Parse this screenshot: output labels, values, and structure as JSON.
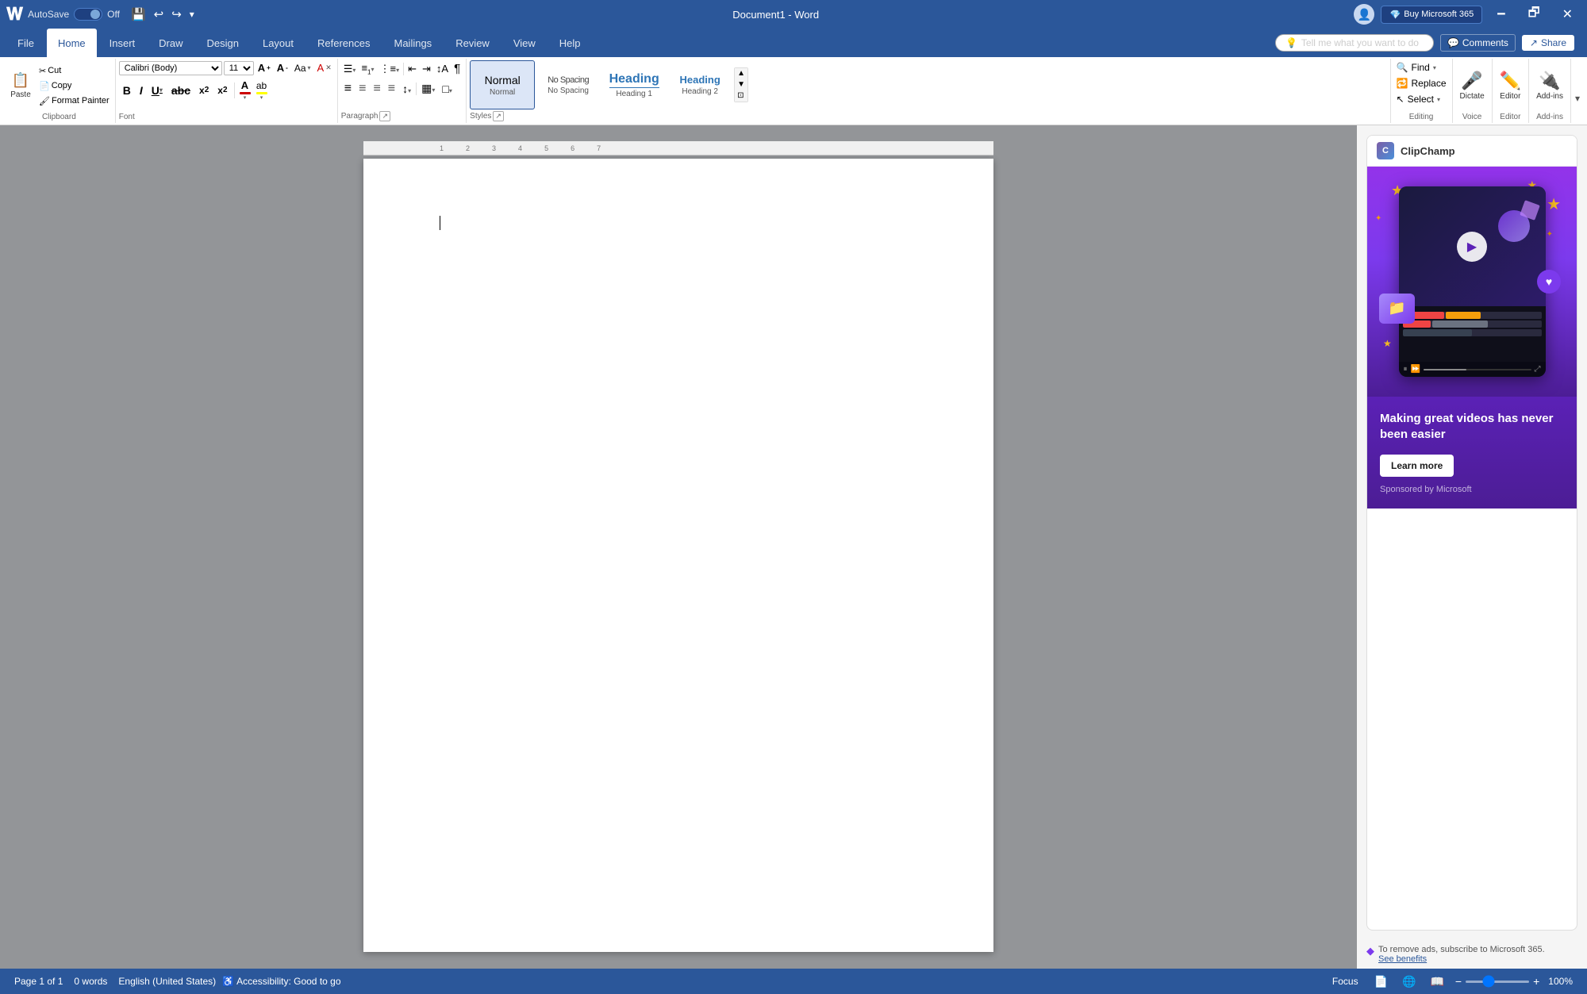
{
  "titlebar": {
    "logo": "W",
    "autosave_label": "AutoSave",
    "autosave_state": "Off",
    "doc_title": "Document1 - Word",
    "save_icon": "💾",
    "undo_icon": "↩",
    "redo_icon": "↪",
    "customize_icon": "▾",
    "minimize": "🗕",
    "restore": "🗗",
    "close": "✕",
    "buy_btn": "Buy Microsoft 365"
  },
  "tabs": [
    {
      "label": "File",
      "active": false
    },
    {
      "label": "Home",
      "active": true
    },
    {
      "label": "Insert",
      "active": false
    },
    {
      "label": "Draw",
      "active": false
    },
    {
      "label": "Design",
      "active": false
    },
    {
      "label": "Layout",
      "active": false
    },
    {
      "label": "References",
      "active": false
    },
    {
      "label": "Mailings",
      "active": false
    },
    {
      "label": "Review",
      "active": false
    },
    {
      "label": "View",
      "active": false
    },
    {
      "label": "Help",
      "active": false
    }
  ],
  "tell_me": {
    "placeholder": "Tell me what you want to do",
    "icon": "💡"
  },
  "toolbar": {
    "clipboard": {
      "label": "Clipboard",
      "paste_label": "Paste",
      "cut_label": "Cut",
      "copy_label": "Copy",
      "format_painter_label": "Format Painter"
    },
    "font": {
      "label": "Font",
      "family": "Calibri (Body)",
      "size": "11",
      "grow_icon": "A↑",
      "shrink_icon": "A↓",
      "case_icon": "Aa",
      "clear_icon": "A✕",
      "bold": "B",
      "italic": "I",
      "underline": "U",
      "strikethrough": "abc",
      "subscript": "x₂",
      "superscript": "x²",
      "font_color": "A",
      "highlight": "ab"
    },
    "paragraph": {
      "label": "Paragraph",
      "bullet_list": "≡•",
      "number_list": "≡1",
      "multi_level": "≡→",
      "decrease_indent": "⇤",
      "increase_indent": "⇥",
      "sort": "↕A",
      "show_marks": "¶",
      "align_left": "≡",
      "align_center": "≡",
      "align_right": "≡",
      "justify": "≡",
      "line_spacing": "↕",
      "shading": "▦",
      "borders": "□"
    },
    "styles": {
      "label": "Styles",
      "items": [
        {
          "label": "Normal",
          "preview": "Normal",
          "selected": true
        },
        {
          "label": "No Spacing",
          "preview": "No Spacing",
          "selected": false
        },
        {
          "label": "Heading 1",
          "preview": "Heading",
          "selected": false
        },
        {
          "label": "Heading 2",
          "preview": "Heading",
          "selected": false
        }
      ],
      "expand_icon": "▾"
    },
    "editing": {
      "label": "Editing",
      "find_label": "Find",
      "replace_label": "Replace",
      "select_label": "Select"
    },
    "voice": {
      "label": "Voice",
      "dictate_label": "Dictate"
    },
    "editor_group": {
      "label": "Editor",
      "editor_label": "Editor"
    },
    "add_ins": {
      "label": "Add-ins",
      "add_ins_label": "Add-ins"
    }
  },
  "collab": {
    "comments_label": "Comments",
    "share_label": "Share"
  },
  "document": {
    "content": "",
    "page_info": "Page 1 of 1",
    "word_count": "0 words",
    "language": "English (United States)",
    "accessibility": "Accessibility: Good to go"
  },
  "status_bar": {
    "page": "Page 1 of 1",
    "words": "0 words",
    "language": "English (United States)",
    "accessibility": "Accessibility: Good to go",
    "focus_label": "Focus",
    "zoom_level": "100%"
  },
  "ad": {
    "logo_text": "ClipChamp",
    "headline": "Making great videos has never been easier",
    "learn_more": "Learn more",
    "sponsored": "Sponsored by Microsoft",
    "remove_ads_text": "To remove ads, subscribe to Microsoft 365.",
    "see_benefits": "See benefits"
  }
}
